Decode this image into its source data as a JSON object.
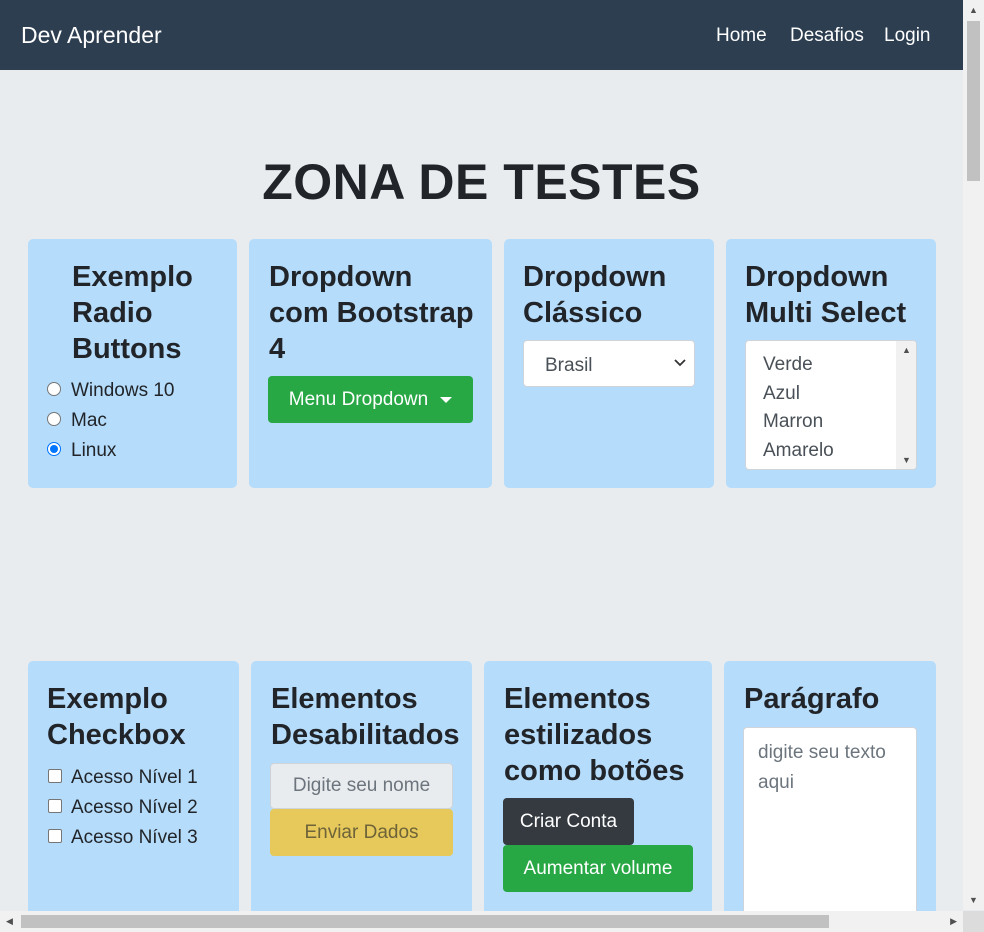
{
  "navbar": {
    "brand": "Dev Aprender",
    "links": [
      "Home",
      "Desafios",
      "Login"
    ]
  },
  "page_title": "ZONA DE TESTES",
  "radio_card": {
    "title": "Exemplo Radio Buttons",
    "title_lines": [
      "Exemplo",
      "Radio",
      "Buttons"
    ],
    "options": [
      "Windows 10",
      "Mac",
      "Linux"
    ],
    "selected": "Linux"
  },
  "dropdown_bootstrap_card": {
    "title_lines": [
      "Dropdown",
      "com Bootstrap",
      "4"
    ],
    "button_label": "Menu Dropdown"
  },
  "dropdown_classic_card": {
    "title_lines": [
      "Dropdown",
      "Clássico"
    ],
    "selected_value": "Brasil"
  },
  "multiselect_card": {
    "title_lines": [
      "Dropdown",
      "Multi Select"
    ],
    "options": [
      "Verde",
      "Azul",
      "Marron",
      "Amarelo"
    ]
  },
  "checkbox_card": {
    "title_lines": [
      "Exemplo",
      "Checkbox"
    ],
    "options": [
      "Acesso Nível 1",
      "Acesso Nível 2",
      "Acesso Nível 3"
    ]
  },
  "disabled_card": {
    "title_lines": [
      "Elementos",
      "Desabilitados"
    ],
    "input_placeholder": "Digite seu nome",
    "button_label": "Enviar Dados"
  },
  "styled_links_card": {
    "title_lines": [
      "Elementos",
      "estilizados",
      "como botões"
    ],
    "dark_button_label": "Criar Conta",
    "green_button_label": "Aumentar volume"
  },
  "paragraph_card": {
    "title": "Parágrafo",
    "placeholder_lines": [
      "digite seu texto",
      "aqui"
    ]
  },
  "colors": {
    "navbar": "#2c3e50",
    "card": "#b6dcfb",
    "background": "#e9ecef",
    "success": "#28a745",
    "dark": "#343a40",
    "warning": "#e6c95a"
  }
}
